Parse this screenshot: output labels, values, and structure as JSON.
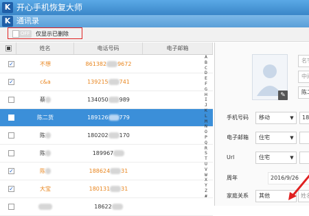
{
  "app": {
    "title": "开心手机恢复大师",
    "logo_letter": "K"
  },
  "section": {
    "title": "通讯录",
    "logo_letter": "K"
  },
  "filter": {
    "toggle_text": "OFF",
    "label": "仅显示已删除"
  },
  "table": {
    "headers": [
      "姓名",
      "电话号码",
      "电子邮箱"
    ],
    "rows": [
      {
        "checked": true,
        "name": "不想",
        "phone_a": "861382",
        "phone_b": "9672",
        "orange": true,
        "selected": false
      },
      {
        "checked": true,
        "name": "c&a",
        "phone_a": "139215",
        "phone_b": "741",
        "orange": true,
        "selected": false
      },
      {
        "checked": false,
        "name": "蔡",
        "phone_a": "134050",
        "phone_b": "989",
        "orange": false,
        "selected": false
      },
      {
        "checked": false,
        "name": "陈二货",
        "phone_a": "189126",
        "phone_b": "779",
        "orange": false,
        "selected": true
      },
      {
        "checked": false,
        "name": "陈",
        "phone_a": "180202",
        "phone_b": "170",
        "orange": false,
        "selected": false
      },
      {
        "checked": false,
        "name": "陈",
        "phone_a": "189967",
        "phone_b": "",
        "orange": false,
        "selected": false
      },
      {
        "checked": true,
        "name": "陈",
        "phone_a": "188624",
        "phone_b": "31",
        "orange": true,
        "selected": false
      },
      {
        "checked": true,
        "name": "大宝",
        "phone_a": "180131",
        "phone_b": "31",
        "orange": true,
        "selected": false
      },
      {
        "checked": false,
        "name": "",
        "phone_a": "18622",
        "phone_b": "",
        "orange": false,
        "selected": false
      }
    ]
  },
  "alpha_index": [
    "A",
    "B",
    "C",
    "D",
    "E",
    "F",
    "G",
    "H",
    "I",
    "J",
    "K",
    "L",
    "M",
    "N",
    "O",
    "P",
    "Q",
    "R",
    "S",
    "T",
    "U",
    "V",
    "W",
    "X",
    "Y",
    "Z",
    "#"
  ],
  "detail": {
    "name_field_1": "名字",
    "name_field_2": "中间",
    "name_field_3": "陈二",
    "phone_label": "手机号码",
    "phone_type": "移动",
    "phone_value": "18",
    "email_label": "电子邮箱",
    "email_type": "住宅",
    "url_label": "Url",
    "url_type": "住宅",
    "anniversary_label": "周年",
    "anniversary_value": "2016/9/26",
    "family_label": "家庭关系",
    "family_type": "其他",
    "family_value": "姓名"
  }
}
